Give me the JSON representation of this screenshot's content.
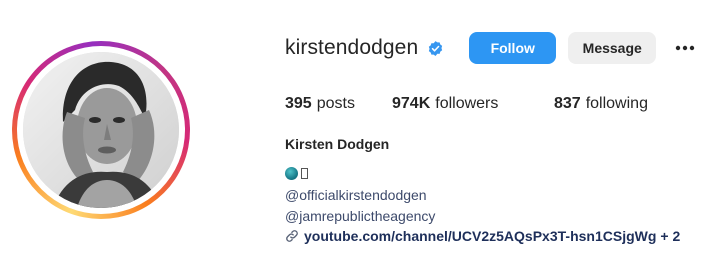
{
  "profile": {
    "username": "kirstendodgen",
    "verified": true,
    "full_name": "Kirsten Dodgen"
  },
  "actions": {
    "follow_label": "Follow",
    "message_label": "Message",
    "more_icon": "more-horizontal-icon"
  },
  "stats": {
    "posts_count": "395",
    "posts_label": "posts",
    "followers_count": "974K",
    "followers_label": "followers",
    "following_count": "837",
    "following_label": "following"
  },
  "bio": {
    "emoji_icons": [
      "globe-icon",
      "unknown-glyph"
    ],
    "mentions": [
      "@officialkirstendodgen",
      "@jamrepublictheagency"
    ],
    "link_text": "youtube.com/channel/UCV2z5AQsPx3T-hsn1CSjgWg",
    "link_extra": "+ 2",
    "link_icon": "link-icon"
  },
  "colors": {
    "follow_button": "#2d96f3",
    "message_button": "#efefef",
    "verified_badge": "#3797f0",
    "mention_text": "#3d4a6b",
    "link_text": "#1e2f5a"
  }
}
